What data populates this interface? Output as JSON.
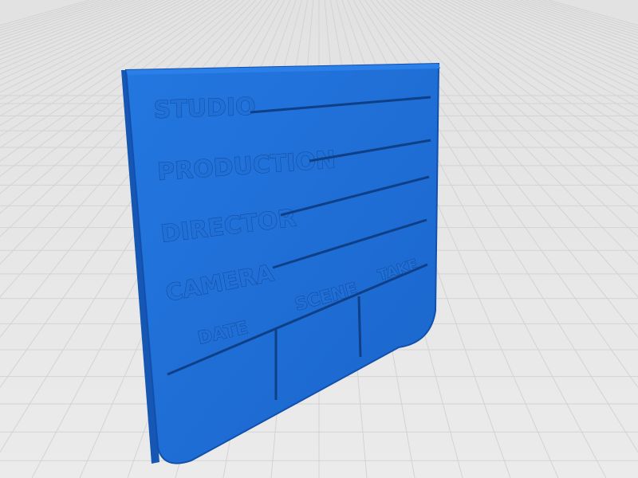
{
  "colors": {
    "background": "#e5e5e5",
    "grid": "#d4d4d4",
    "board_face": "#1e6fd6",
    "board_edge": "#0f4aa3",
    "board_side": "#175dbb",
    "engraving": "#0f3f86"
  },
  "board": {
    "fields": [
      {
        "label": "STUDIO"
      },
      {
        "label": "PRODUCTION"
      },
      {
        "label": "DIRECTOR"
      },
      {
        "label": "CAMERA"
      }
    ],
    "columns": [
      {
        "label": "DATE"
      },
      {
        "label": "SCENE"
      },
      {
        "label": "TAKE"
      }
    ]
  }
}
